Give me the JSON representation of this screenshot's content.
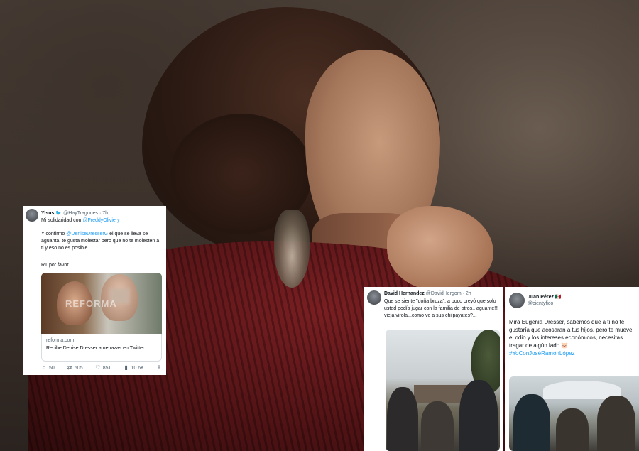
{
  "tweet1": {
    "display_name": "Yisus",
    "handle": "@HayTragones",
    "time": "· 7h",
    "line1_text": "Mi solidaridad con ",
    "line1_mention": "@FreddyOliviery",
    "body_pre": "Y confirmo ",
    "body_mention": "@DeniseDresserG",
    "body_post": " el que se lleva se aguanta, te gusta molestar pero que no te molesten a ti y eso no es posible.",
    "rt_line": "RT por favor.",
    "watermark": "REFORMA",
    "link_domain": "reforma.com",
    "link_title": "Recibe Denise Dresser amenazas en Twitter",
    "replies": "50",
    "retweets": "505",
    "likes": "851",
    "views": "10.6K"
  },
  "tweet2": {
    "display_name": "David Hernandez",
    "handle": "@DavidHergom",
    "time": "· 2h",
    "body": "Que se siente \"doña broza\", a poco creyó que solo usted podía jugar con la familia de otros.. aguante!!! vieja virola...como ve a sus chilpayates?..."
  },
  "tweet3": {
    "display_name": "Juan Pérez",
    "flag": "🇲🇽",
    "handle": "@cientyfico",
    "body": "Mira Eugenia Dresser, sabemos que a ti no te gustaría que acosaran a tus hijos, pero te mueve el odio y los intereses económicos, necesitas tragar de algún lado 🐷",
    "hashtag": "#YoConJoséRamónLópez"
  },
  "icons": {
    "reply": "reply-icon",
    "retweet": "retweet-icon",
    "like": "heart-icon",
    "views": "views-icon",
    "share": "share-icon"
  }
}
